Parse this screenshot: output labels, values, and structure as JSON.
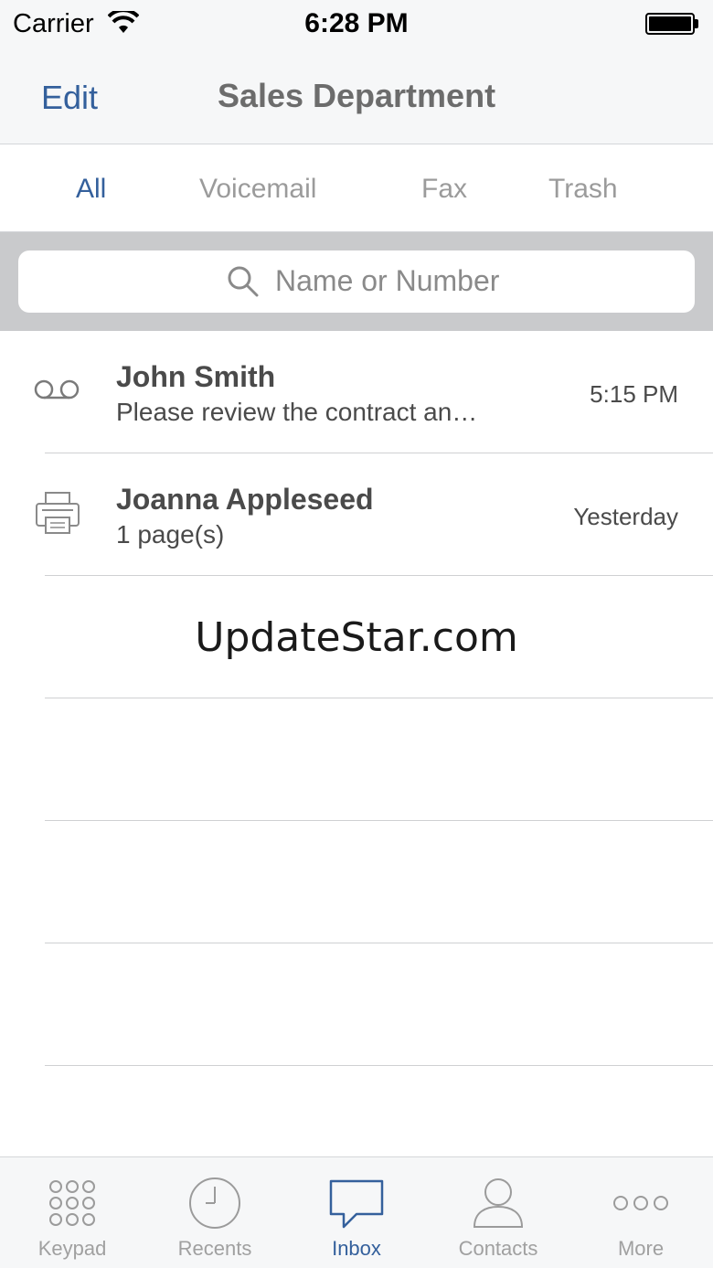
{
  "status_bar": {
    "carrier": "Carrier",
    "time": "6:28 PM"
  },
  "nav": {
    "edit_label": "Edit",
    "title": "Sales Department"
  },
  "tabs": [
    {
      "label": "All",
      "active": true
    },
    {
      "label": "Voicemail",
      "active": false
    },
    {
      "label": "Fax",
      "active": false
    },
    {
      "label": "Trash",
      "active": false
    }
  ],
  "search": {
    "placeholder": "Name or Number",
    "icon": "search-icon"
  },
  "messages": [
    {
      "type": "voicemail",
      "icon": "voicemail-icon",
      "name": "John Smith",
      "preview": "Please review the contract an…",
      "time": "5:15 PM"
    },
    {
      "type": "fax",
      "icon": "fax-icon",
      "name": "Joanna Appleseed",
      "preview": "1 page(s)",
      "time": "Yesterday"
    }
  ],
  "watermark": "UpdateStar.com",
  "tab_bar": [
    {
      "label": "Keypad",
      "icon": "keypad-icon",
      "active": false
    },
    {
      "label": "Recents",
      "icon": "clock-icon",
      "active": false
    },
    {
      "label": "Inbox",
      "icon": "chat-bubble-icon",
      "active": true
    },
    {
      "label": "Contacts",
      "icon": "person-icon",
      "active": false
    },
    {
      "label": "More",
      "icon": "more-dots-icon",
      "active": false
    }
  ],
  "colors": {
    "accent": "#34609c",
    "inactive": "#9b9b9b",
    "bar_background": "#f6f7f8",
    "search_background": "#c9cacc"
  }
}
